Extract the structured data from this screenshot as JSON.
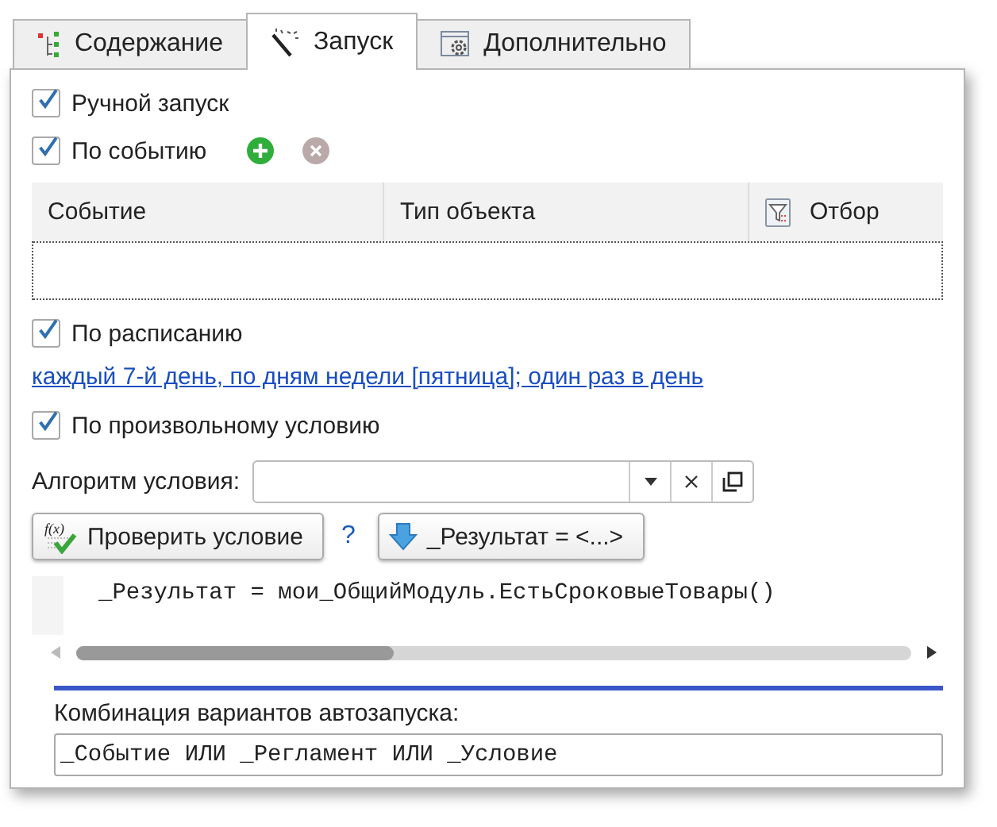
{
  "tabs": [
    {
      "label": "Содержание",
      "kind": "tree",
      "selected": false
    },
    {
      "label": "Запуск",
      "kind": "wand",
      "selected": true
    },
    {
      "label": "Дополнительно",
      "kind": "settings",
      "selected": false
    }
  ],
  "manual_start": {
    "label": "Ручной запуск",
    "checked": true
  },
  "by_event": {
    "label": "По событию",
    "checked": true,
    "add_disabled": false,
    "remove_disabled": true
  },
  "events_table": {
    "columns": [
      {
        "label": "Событие",
        "kind": "text"
      },
      {
        "label": "Тип объекта",
        "kind": "text"
      },
      {
        "label": "Отбор",
        "kind": "filter"
      }
    ]
  },
  "by_schedule": {
    "label": "По расписанию",
    "checked": true,
    "schedule_link": "каждый 7-й день, по дням недели [пятница]; один раз в день"
  },
  "by_condition": {
    "label": "По произвольному условию",
    "checked": true
  },
  "algorithm": {
    "label": "Алгоритм условия:"
  },
  "check_button": {
    "label": "Проверить условие",
    "icon_text": "f(x)"
  },
  "help": "?",
  "result_button": {
    "label": "_Результат = <...>"
  },
  "code": "_Результат = мои_ОбщийМодуль.ЕстьСроковыеТовары()",
  "combination": {
    "label": "Комбинация вариантов автозапуска:",
    "value": "_Событие ИЛИ _Регламент ИЛИ _Условие"
  }
}
